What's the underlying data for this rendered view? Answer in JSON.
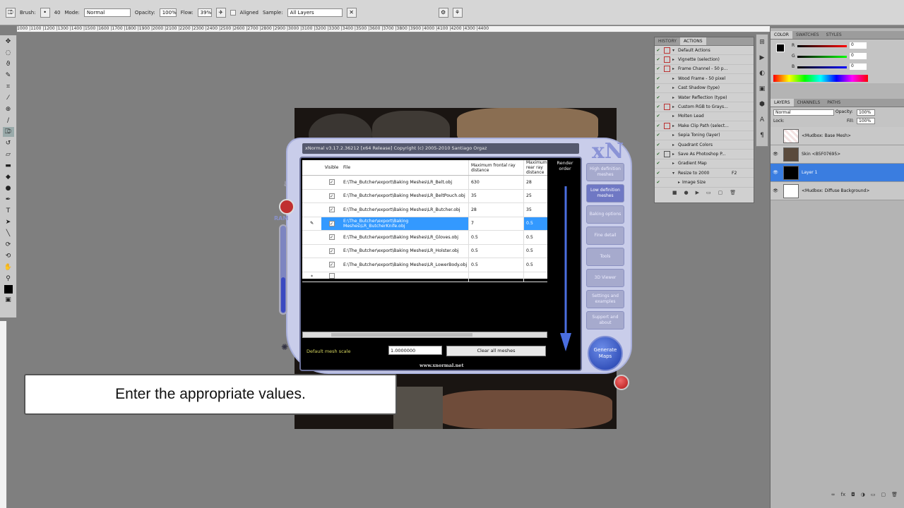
{
  "options_bar": {
    "brush_label": "Brush:",
    "brush_size": "40",
    "mode_label": "Mode:",
    "mode_value": "Normal",
    "opacity_label": "Opacity:",
    "opacity_value": "100%",
    "flow_label": "Flow:",
    "flow_value": "39%",
    "aligned_label": "Aligned",
    "sample_label": "Sample:",
    "sample_value": "All Layers"
  },
  "ruler_marks": "1000 |1100 |1200 |1300 |1400 |1500 |1600 |1700 |1800 |1900 |2000 |2100 |2200 |2300 |2400 |2500 |2600 |2700 |2800 |2900 |3000 |3100 |3200 |3300 |3400 |3500 |3600 |3700 |3800 |3900 |4000 |4100 |4200 |4300 |4400",
  "history_panel": {
    "tabs": [
      "History",
      "Actions"
    ],
    "items": [
      "Default Actions",
      "Vignette (selection)",
      "Frame Channel - 50 p...",
      "Wood Frame - 50 pixel",
      "Cast Shadow (type)",
      "Water Reflection (type)",
      "Custom RGB to Grays...",
      "Molten Lead",
      "Make Clip Path (select...",
      "Sepia Toning (layer)",
      "Quadrant Colors",
      "Save As Photoshop P...",
      "Gradient Map",
      "Resize to 2000",
      "Image Size"
    ],
    "shortcut": "F2"
  },
  "color_panel": {
    "tabs": [
      "Color",
      "Swatches",
      "Styles"
    ],
    "r_label": "R",
    "g_label": "G",
    "b_label": "B",
    "r": "0",
    "g": "0",
    "b": "0"
  },
  "layers_panel": {
    "tabs": [
      "Layers",
      "Channels",
      "Paths"
    ],
    "blend_mode": "Normal",
    "opacity_label": "Opacity:",
    "opacity": "100%",
    "lock_label": "Lock:",
    "fill_label": "Fill:",
    "fill": "100%",
    "layers": [
      "<Mudbox: Base Mesh>",
      "Skin <B5F07695>",
      "Layer 1",
      "<Mudbox: Diffuse Background>"
    ]
  },
  "xnormal": {
    "title": "xNormal v3.17.2.36212 [x64 Release] Copyright (c) 2005-2010  Santiago Orgaz",
    "logo": "xN",
    "ram_label": "RAM",
    "columns": [
      "Visible",
      "File",
      "Maximum frontal ray distance",
      "Maximum rear ray distance",
      "Render order"
    ],
    "rows": [
      {
        "file": "E:\\The_Butcher\\export\\Baking Meshes\\LR_Belt.obj",
        "front": "630",
        "rear": "28"
      },
      {
        "file": "E:\\The_Butcher\\export\\Baking Meshes\\LR_BeltPouch.obj",
        "front": "35",
        "rear": "25"
      },
      {
        "file": "E:\\The_Butcher\\export\\Baking Meshes\\LR_Butcher.obj",
        "front": "28",
        "rear": "35"
      },
      {
        "file": "E:\\The_Butcher\\export\\Baking Meshes\\LR_ButcherKnife.obj",
        "front": "7",
        "rear": "0.5"
      },
      {
        "file": "E:\\The_Butcher\\export\\Baking Meshes\\LR_Gloves.obj",
        "front": "0.5",
        "rear": "0.5"
      },
      {
        "file": "E:\\The_Butcher\\export\\Baking Meshes\\LR_Holster.obj",
        "front": "0.5",
        "rear": "0.5"
      },
      {
        "file": "E:\\The_Butcher\\export\\Baking Meshes\\LR_LowerBody.obj",
        "front": "0.5",
        "rear": "0.5"
      }
    ],
    "new_row_marker": "*",
    "scale_label": "Default mesh scale",
    "scale_value": "1.0000000",
    "clear_button": "Clear all meshes",
    "website": "www.xnormal.net",
    "side_buttons": [
      "High definition meshes",
      "Low definition meshes",
      "Baking options",
      "Fine detail",
      "Tools",
      "3D Viewer",
      "Settings and examples",
      "Support and about"
    ],
    "generate_button": "Generate Maps"
  },
  "caption": "Enter the appropriate values."
}
